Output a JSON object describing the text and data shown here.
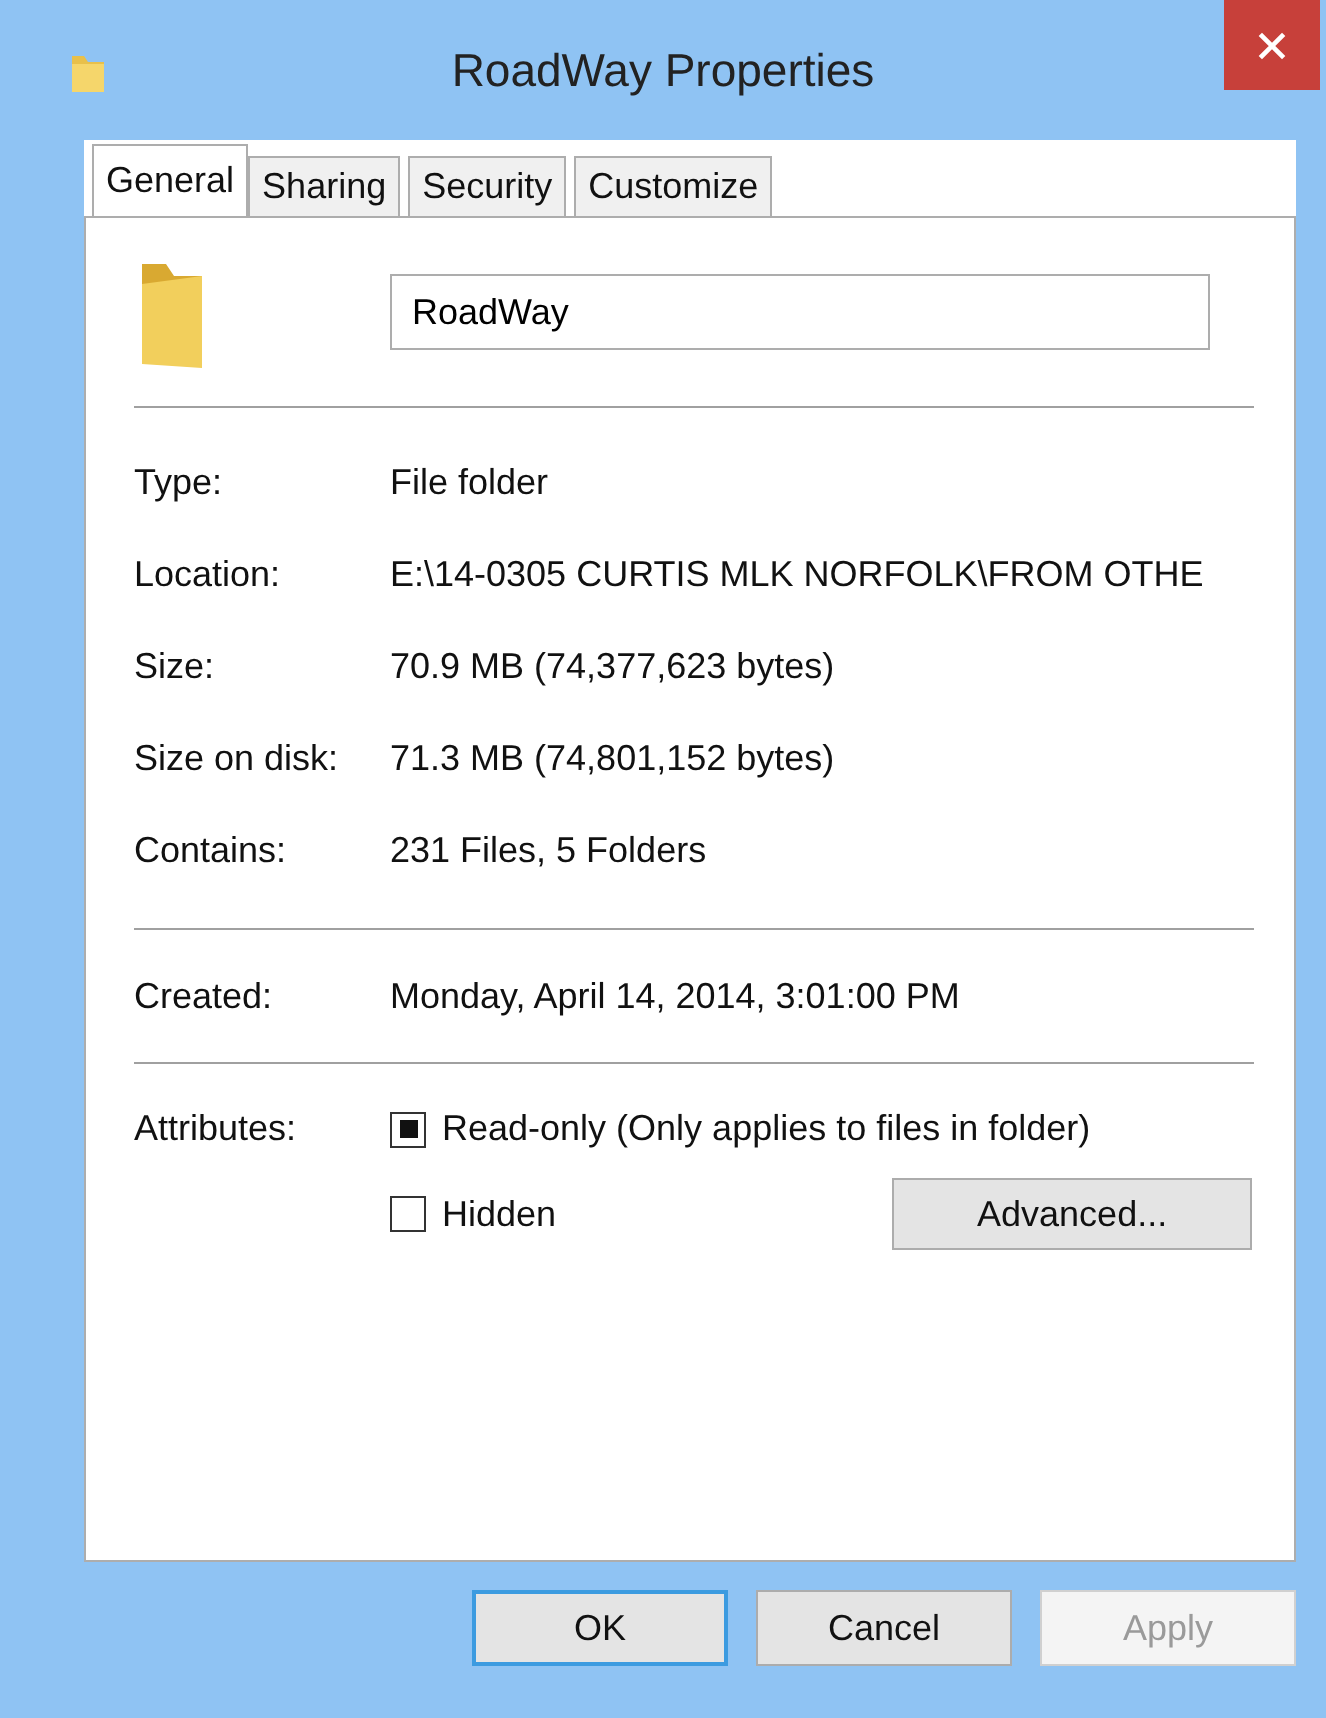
{
  "window": {
    "title": "RoadWay Properties"
  },
  "tabs": [
    {
      "label": "General",
      "selected": true
    },
    {
      "label": "Sharing",
      "selected": false
    },
    {
      "label": "Security",
      "selected": false
    },
    {
      "label": "Customize",
      "selected": false
    }
  ],
  "name_field": {
    "value": "RoadWay"
  },
  "details": [
    {
      "label": "Type:",
      "value": "File folder"
    },
    {
      "label": "Location:",
      "value": "E:\\14-0305 CURTIS MLK NORFOLK\\FROM OTHE"
    },
    {
      "label": "Size:",
      "value": "70.9 MB (74,377,623 bytes)"
    },
    {
      "label": "Size on disk:",
      "value": "71.3 MB (74,801,152 bytes)"
    },
    {
      "label": "Contains:",
      "value": "231 Files, 5 Folders"
    }
  ],
  "created": {
    "label": "Created:",
    "value": "Monday, April 14, 2014, 3:01:00 PM"
  },
  "attributes": {
    "label": "Attributes:",
    "items": [
      {
        "label": "Read-only (Only applies to files in folder)",
        "checked": false,
        "indeterminate": true
      },
      {
        "label": "Hidden",
        "checked": false,
        "indeterminate": false
      }
    ],
    "advanced_button": "Advanced..."
  },
  "buttons": [
    {
      "label": "OK",
      "disabled": false,
      "default": true
    },
    {
      "label": "Cancel",
      "disabled": false,
      "default": false
    },
    {
      "label": "Apply",
      "disabled": true,
      "default": false
    }
  ]
}
